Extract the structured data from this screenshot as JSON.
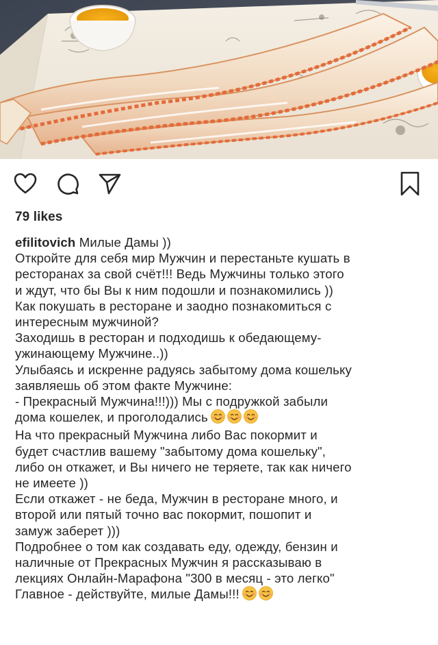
{
  "post": {
    "likes": "79 likes",
    "username": "efilitovich",
    "caption_first": "Милые Дамы ))",
    "caption_lines": [
      "Откройте для себя мир Мужчин и перестаньте кушать в",
      "ресторанах за свой счёт!!! Ведь Мужчины только этого",
      "и ждут, что бы Вы к ним подошли и познакомились ))",
      "Как покушать в ресторане и заодно познакомиться с",
      "интересным мужчиной?",
      "Заходишь в ресторан и подходишь к обедающему-",
      "ужинающему Мужчине..))",
      "Улыбаясь и искренне радуясь забытому дома кошельку",
      "заявляешь об этом факте Мужчине:",
      "- Прекрасный Мужчина!!!))) Мы с подружкой забыли"
    ],
    "caption_line_emoji_1": "дома кошелек, и проголодались",
    "caption_lines_2": [
      "На что прекрасный Мужчина либо Вас покормит и",
      "будет счастлив вашему \"забытому дома кошельку\",",
      "либо он откажет, и Вы ничего не теряете, так как ничего",
      "не имеете ))",
      "Если откажет - не беда, Мужчин в ресторане много, и",
      "второй или пятый точно вас покормит, пошопит и",
      "замуж заберет )))",
      "Подробнее о том как создавать еду, одежду, бензин и",
      "наличные от Прекрасных Мужчин я рассказываю в",
      "лекциях Онлайн-Марафона \"300 в месяц - это легко\""
    ],
    "caption_line_emoji_2": "Главное - действуйте, милые Дамы!!!"
  },
  "icons": {
    "like": "heart-outline-icon",
    "comment": "comment-bubble-icon",
    "share": "paper-plane-icon",
    "save": "bookmark-icon",
    "emoji": "smiling-face-emoji"
  },
  "colors": {
    "text": "#262626",
    "emoji_face": "#f7c244",
    "emoji_blush": "#f08d6f"
  }
}
